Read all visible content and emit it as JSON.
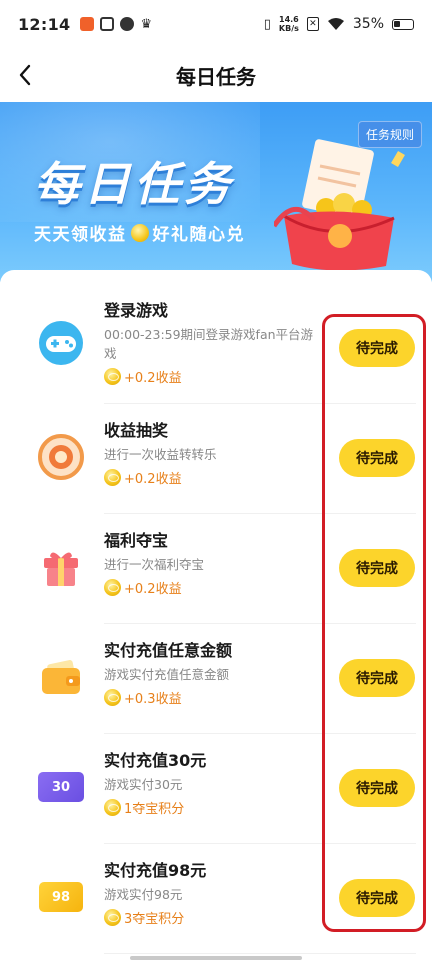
{
  "status": {
    "time": "12:14",
    "speed_value": "14.6",
    "speed_unit": "KB/s",
    "battery": "35%"
  },
  "nav": {
    "title": "每日任务"
  },
  "banner": {
    "rules": "任务规则",
    "title": "每日任务",
    "subtitle_left": "天天领收益",
    "subtitle_right": "好礼随心兑"
  },
  "tasks": [
    {
      "title": "登录游戏",
      "desc": "00:00-23:59期间登录游戏fan平台游戏",
      "reward": "+0.2收益",
      "button": "待完成",
      "icon": "gamepad-icon"
    },
    {
      "title": "收益抽奖",
      "desc": "进行一次收益转转乐",
      "reward": "+0.2收益",
      "button": "待完成",
      "icon": "spin-wheel-icon"
    },
    {
      "title": "福利夺宝",
      "desc": "进行一次福利夺宝",
      "reward": "+0.2收益",
      "button": "待完成",
      "icon": "gift-box-icon"
    },
    {
      "title": "实付充值任意金额",
      "desc": "游戏实付充值任意金额",
      "reward": "+0.3收益",
      "button": "待完成",
      "icon": "wallet-icon"
    },
    {
      "title": "实付充值30元",
      "desc": "游戏实付30元",
      "reward": "1夺宝积分",
      "button": "待完成",
      "icon": "ticket-30-icon",
      "badge": "30"
    },
    {
      "title": "实付充值98元",
      "desc": "游戏实付98元",
      "reward": "3夺宝积分",
      "button": "待完成",
      "icon": "ticket-98-icon",
      "badge": "98"
    }
  ],
  "colors": {
    "button": "#fcd42b",
    "reward": "#e7801a",
    "annotation": "#d21d25",
    "banner": "#3d9df5"
  }
}
